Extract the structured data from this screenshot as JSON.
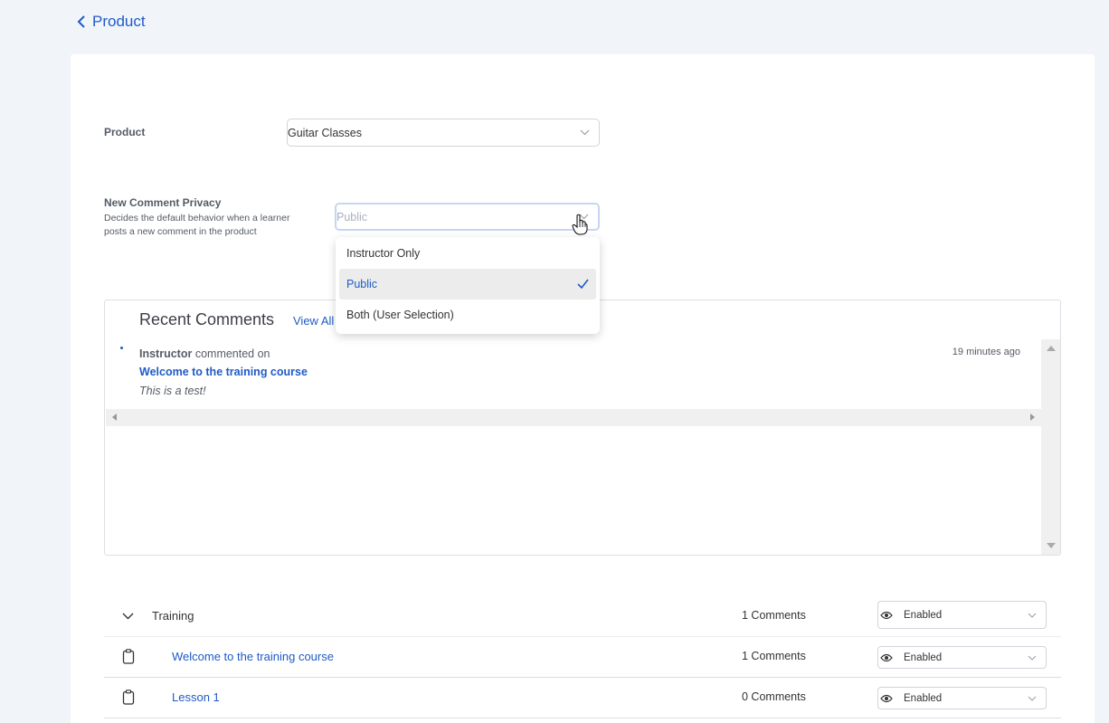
{
  "header": {
    "back_label": "Product"
  },
  "form": {
    "product_label": "Product",
    "product_value": "Guitar Classes",
    "privacy_label": "New Comment Privacy",
    "privacy_description": "Decides the default behavior when a learner posts a new comment in the product",
    "privacy_value": "Public",
    "privacy_options": [
      {
        "label": "Instructor Only",
        "selected": false
      },
      {
        "label": "Public",
        "selected": true
      },
      {
        "label": "Both (User Selection)",
        "selected": false
      }
    ]
  },
  "recent_comments": {
    "title": "Recent Comments",
    "view_all": "View All",
    "items": [
      {
        "author": "Instructor",
        "action": "commented on",
        "target": "Welcome to the training course",
        "text": "This is a test!",
        "time": "19 minutes ago"
      }
    ]
  },
  "table": {
    "rows": [
      {
        "name": "Training",
        "count": "1 Comments",
        "status": "Enabled",
        "type": "chapter"
      },
      {
        "name": "Welcome to the training course",
        "count": "1 Comments",
        "status": "Enabled",
        "type": "lesson"
      },
      {
        "name": "Lesson 1",
        "count": "0 Comments",
        "status": "Enabled",
        "type": "lesson"
      }
    ]
  },
  "colors": {
    "accent": "#1f5bc6",
    "background": "#f1f5f9",
    "selected_bg": "#ececed"
  }
}
